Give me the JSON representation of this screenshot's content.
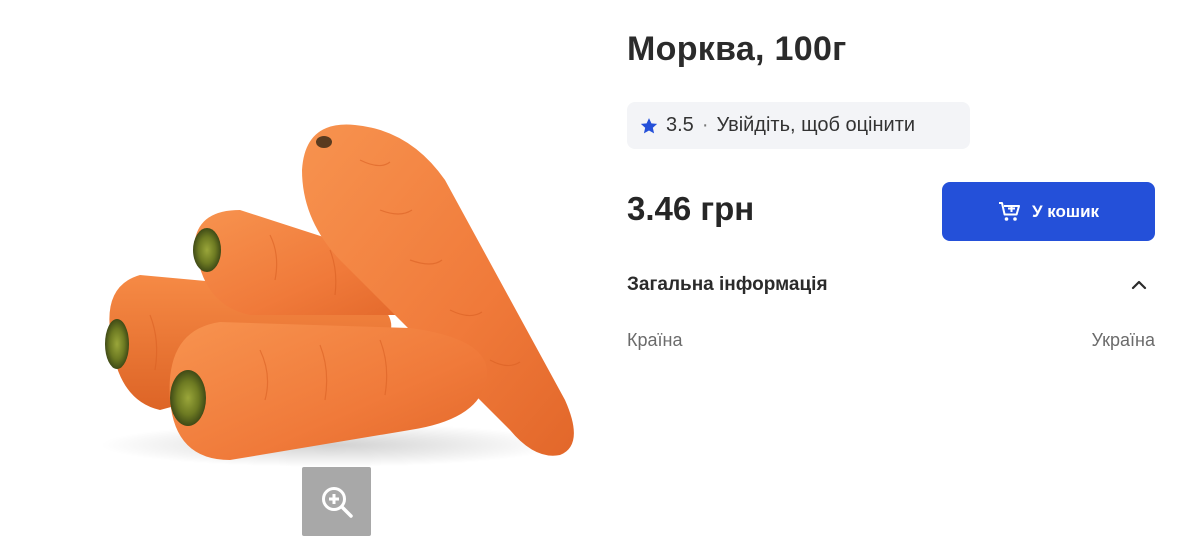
{
  "product": {
    "title": "Морква, 100г",
    "image_alt": "carrots",
    "rating": {
      "value": "3.5",
      "separator": "·",
      "login_prompt": "Увійдіть, щоб оцінити",
      "icon": "star-icon"
    },
    "price": "3.46 грн",
    "add_to_cart_label": "У кошик"
  },
  "general_info": {
    "title": "Загальна інформація",
    "rows": [
      {
        "label": "Країна",
        "value": "Україна"
      }
    ]
  },
  "colors": {
    "accent": "#2450d9",
    "text": "#2b2b2b",
    "muted": "#6b6b6b",
    "pill_bg": "#f3f4f7",
    "carrot": "#f07a3a"
  }
}
